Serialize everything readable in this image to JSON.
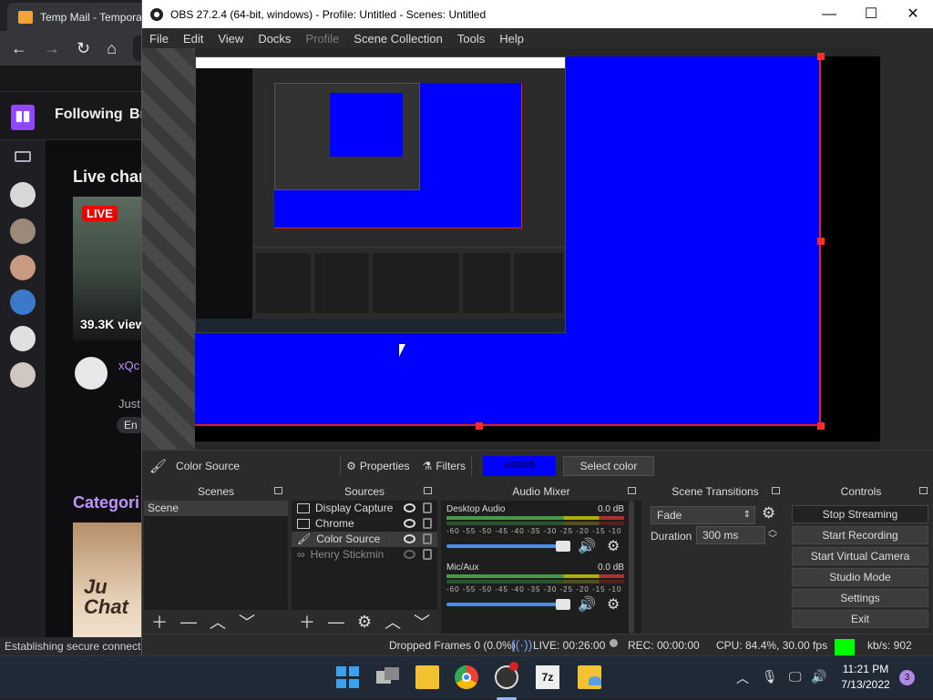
{
  "browser": {
    "tab_title": "Temp Mail - Tempora",
    "twitch": {
      "following": "Following",
      "browse_partial": "Br",
      "section_title": "Live char",
      "live_badge": "LIVE",
      "viewers": "39.3K view",
      "channel_name": "xQc",
      "channel_text": "Just",
      "tag": "En",
      "categories_title": "Categori",
      "category_thumb_text": "Ju Chat"
    },
    "status_text": "Establishing secure connecti"
  },
  "obs": {
    "title": "OBS 27.2.4 (64-bit, windows) - Profile: Untitled - Scenes: Untitled",
    "menu": [
      "File",
      "Edit",
      "View",
      "Docks",
      "Profile",
      "Scene Collection",
      "Tools",
      "Help"
    ],
    "source_toolbar": {
      "source_name": "Color Source",
      "properties": "Properties",
      "filters": "Filters",
      "color_hex": "#0000ff",
      "select_color": "Select color"
    },
    "scenes": {
      "title": "Scenes",
      "items": [
        "Scene"
      ]
    },
    "sources": {
      "title": "Sources",
      "items": [
        {
          "name": "Display Capture"
        },
        {
          "name": "Chrome"
        },
        {
          "name": "Color Source"
        },
        {
          "name": "Henry Stickmin"
        }
      ]
    },
    "audio_mixer": {
      "title": "Audio Mixer",
      "scale": "-60 -55 -50 -45 -40 -35 -30 -25 -20 -15 -10 -5 0",
      "channels": [
        {
          "name": "Desktop Audio",
          "db": "0.0 dB",
          "level": 0.92
        },
        {
          "name": "Mic/Aux",
          "db": "0.0 dB",
          "level": 0.92
        }
      ]
    },
    "transitions": {
      "title": "Scene Transitions",
      "type": "Fade",
      "duration_label": "Duration",
      "duration": "300 ms"
    },
    "controls": {
      "title": "Controls",
      "buttons": [
        "Stop Streaming",
        "Start Recording",
        "Start Virtual Camera",
        "Studio Mode",
        "Settings",
        "Exit"
      ]
    },
    "status": {
      "dropped": "Dropped Frames 0 (0.0%)",
      "live": "LIVE: 00:26:00",
      "rec": "REC: 00:00:00",
      "cpu": "CPU: 84.4%, 30.00 fps",
      "kbs": "kb/s: 902"
    }
  },
  "taskbar": {
    "time": "11:21 PM",
    "date": "7/13/2022",
    "notifications": "3",
    "app_7z": "7z"
  },
  "colors": {
    "accent_blue": "#0000ff",
    "selection_red": "#e02020",
    "status_green": "#00ff00",
    "twitch_purple": "#9146ff"
  }
}
